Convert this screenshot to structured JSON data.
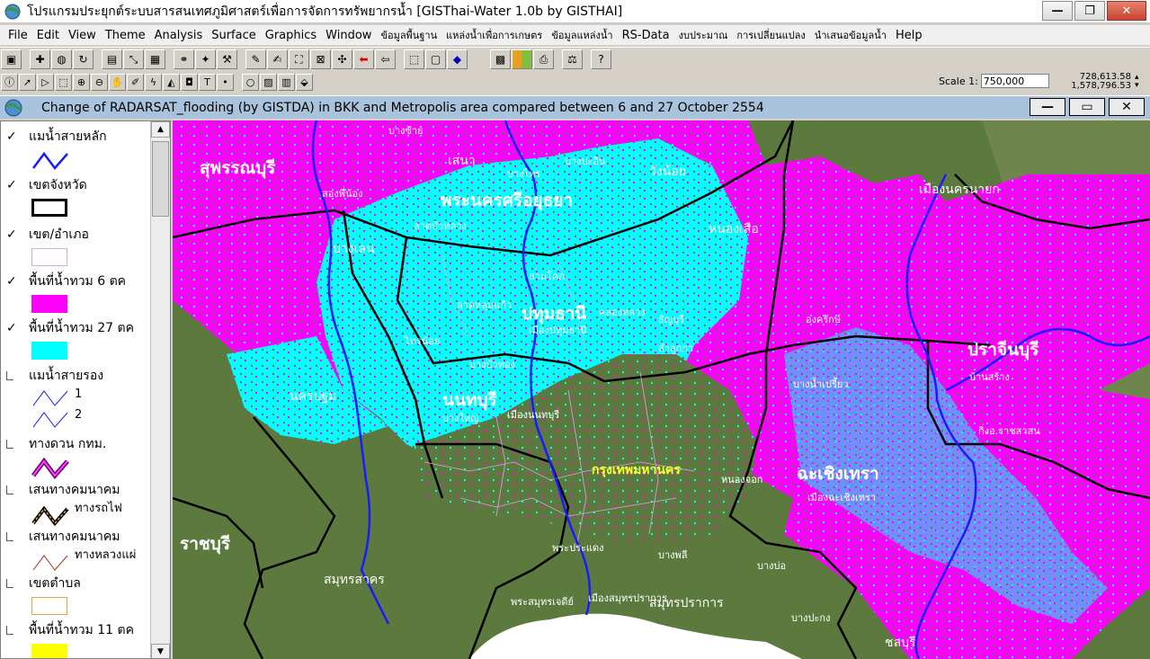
{
  "window": {
    "title": "โปรแกรมประยุกต์ระบบสารสนเทศภูมิศาสตร์เพื่อการจัดการทรัพยากรน้ำ  [GISThai-Water 1.0b   by GISTHAI]",
    "minimize": "—",
    "restore": "❐",
    "close": "✕"
  },
  "menu": [
    "File",
    "Edit",
    "View",
    "Theme",
    "Analysis",
    "Surface",
    "Graphics",
    "Window"
  ],
  "menu_thai": [
    "ข้อมูลพื้นฐาน",
    "แหล่งน้ำเพื่อการเกษตร",
    "ข้อมูลแหล่งน้ำ"
  ],
  "menu_rs": "RS-Data",
  "menu_thai2": [
    "งบประมาณ",
    "การเปลี่ยนแปลง",
    "นำเสนอข้อมูลน้ำ"
  ],
  "menu_help": "Help",
  "toolbar1_icons": [
    "save-icon",
    "add-theme-icon",
    "theme-props-icon",
    "edit-legend-icon",
    "table-icon",
    "query-builder-icon",
    "locate-icon",
    "find-icon",
    "hotlink-icon",
    "tools-icon",
    "layout-icon",
    "chart-icon",
    "zoom-full-icon",
    "zoom-active-icon",
    "zoom-selected-icon",
    "back-icon",
    "forward-icon",
    "select-all-icon",
    "clear-selection-icon",
    "promote-icon",
    "color-icon",
    "legend-icon",
    "print-icon",
    "attribute-icon",
    "help-icon"
  ],
  "toolbar2_icons": [
    "identify-icon",
    "pointer-icon",
    "vertex-icon",
    "select-feature-icon",
    "zoom-in-icon",
    "zoom-out-icon",
    "pan-icon",
    "measure-icon",
    "hotlink-tool-icon",
    "area-icon",
    "label-icon",
    "text-icon",
    "point-icon",
    "circle-icon",
    "image-icon",
    "chart-tool-icon",
    "snap-icon"
  ],
  "scale": {
    "label": "Scale 1:",
    "value": "750,000"
  },
  "coords": {
    "x": "728,613.58",
    "y": "1,578,796.53"
  },
  "view": {
    "title": "Change of RADARSAT_flooding (by GISTDA) in BKK and Metropolis area compared between 6 and 27 October 2554",
    "minimize": "—",
    "maximize": "▭",
    "close": "✕"
  },
  "legend": {
    "items": [
      {
        "label": "แมน้ำสายหลัก",
        "checked": true
      },
      {
        "label": "เขตจังหวัด",
        "checked": true
      },
      {
        "label": "เขต/อำเภอ",
        "checked": true
      },
      {
        "label": "พื้นที่น้ำทวม 6 ตค",
        "checked": true,
        "color": "#ff00ff"
      },
      {
        "label": "พื้นที่น้ำทวม 27 ตค",
        "checked": true,
        "color": "#00ffff"
      },
      {
        "label": "แมน้ำสายรอง",
        "checked": false,
        "sub": [
          "1",
          "2"
        ]
      },
      {
        "label": "ทางดวน กทม.",
        "checked": false
      },
      {
        "label": "เสนทางคมนาคม",
        "checked": false,
        "sub": [
          "ทางรถไฟ"
        ]
      },
      {
        "label": "เสนทางคมนาคม",
        "checked": false,
        "sub": [
          "ทางหลวงแผ่"
        ]
      },
      {
        "label": "เขตตำบล",
        "checked": false
      },
      {
        "label": "พื้นที่น้ำทวม 11 ตค",
        "checked": false,
        "color": "#ffff00"
      }
    ]
  },
  "colors": {
    "flood_6_oct": "#ff00ff",
    "flood_27_oct": "#00ffff",
    "flood_11_oct": "#ffff00",
    "river": "#1a1aff",
    "land": "#5c7a3e",
    "sea": "#ffffff"
  },
  "map_labels": {
    "provinces": [
      "สุพรรณบุรี",
      "พระนครศรีอยุธยา",
      "ปทุมธานี",
      "นนทบุรี",
      "นครปฐม",
      "ฉะเชิงเทรา",
      "ปราจีนบุรี",
      "ราชบุรี",
      "สมุทรสาคร",
      "นครนายก",
      "ชลบุรี"
    ],
    "bangkok": "กรุงเทพมหานคร",
    "districts": [
      "บางซ้าย",
      "เสนา",
      "บางไทร",
      "บางปะอิน",
      "วังน้อย",
      "สองพี่น้อง",
      "บางเลน",
      "ลาดบัวหลวง",
      "หนองเสือ",
      "เมืองนครนายก",
      "สามโคก",
      "ลาดหลุมแก้ว",
      "คลองหลวง",
      "ธัญบุรี",
      "ลำลูกกา",
      "องครักษ์",
      "บางบัวทอง",
      "ไทรน้อย",
      "บางใหญ่",
      "เมืองนนทบุรี",
      "บางน้ำเปรี้ยว",
      "บ้านสร้าง",
      "กิ่งอ.ราชสาสน",
      "เมืองฉะเชิงเทรา",
      "บางพลี",
      "บางบ่อ",
      "บางปะกง",
      "พระสมุทรเจดีย์",
      "เมืองสมุทรปราการ",
      "พระประแดง",
      "สมุทรปราการ",
      "เมืองปทุมธานี",
      "หนองจอก",
      "บางไทร"
    ]
  }
}
